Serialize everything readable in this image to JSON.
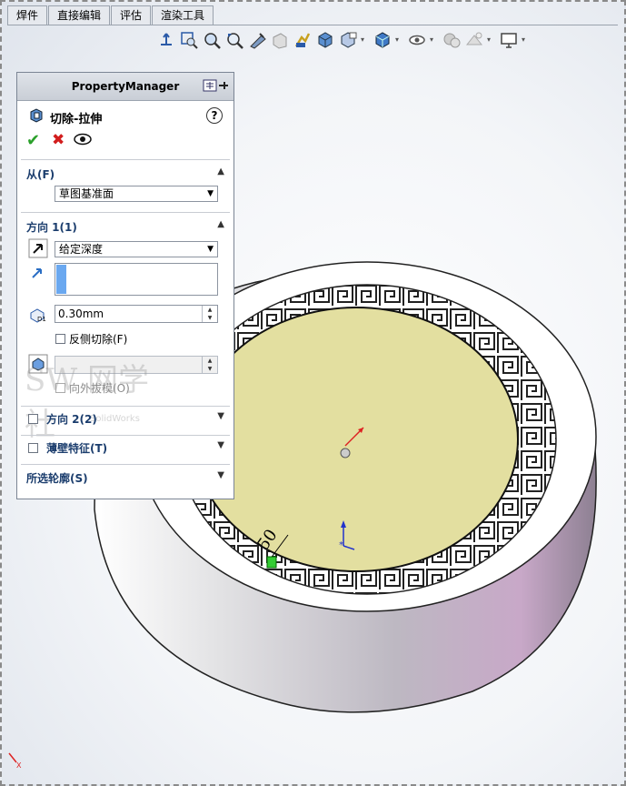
{
  "tabs": [
    "焊件",
    "直接编辑",
    "评估",
    "渲染工具"
  ],
  "hud_icons": [
    "view-orientation-icon",
    "zoom-to-fit-icon",
    "zoom-to-area-icon",
    "previous-view-icon",
    "section-view-icon",
    "dynamic-annotation-icon",
    "view-settings-icon",
    "display-style-icon",
    "hide-show-icon",
    "edit-appearance-icon",
    "apply-scene-icon",
    "view-settings-icon-2",
    "monitor-icon"
  ],
  "property_manager": {
    "header": "PropertyManager",
    "feature_title": "切除-拉伸",
    "help": "?",
    "from_section": {
      "title": "从(F)",
      "value": "草图基准面"
    },
    "direction1": {
      "title": "方向 1(1)",
      "end_condition": "给定深度",
      "depth": "0.30mm",
      "flip_side_label": "反侧切除(F)",
      "draft_outward_label": "向外拔模(O)"
    },
    "direction2": {
      "title": "方向 2(2)"
    },
    "thin_feature": {
      "title": "薄壁特征(T)"
    },
    "selected_contours": {
      "title": "所选轮廓(S)"
    }
  },
  "watermark": {
    "text": "SW 网学社",
    "sub": "SolidWorks"
  },
  "dimension_label": "50",
  "colors": {
    "accent": "#1b3d6d",
    "face_fill": "#e3dfa0",
    "ring": "#ffffff",
    "body_highlight": "#c8a8c8"
  }
}
